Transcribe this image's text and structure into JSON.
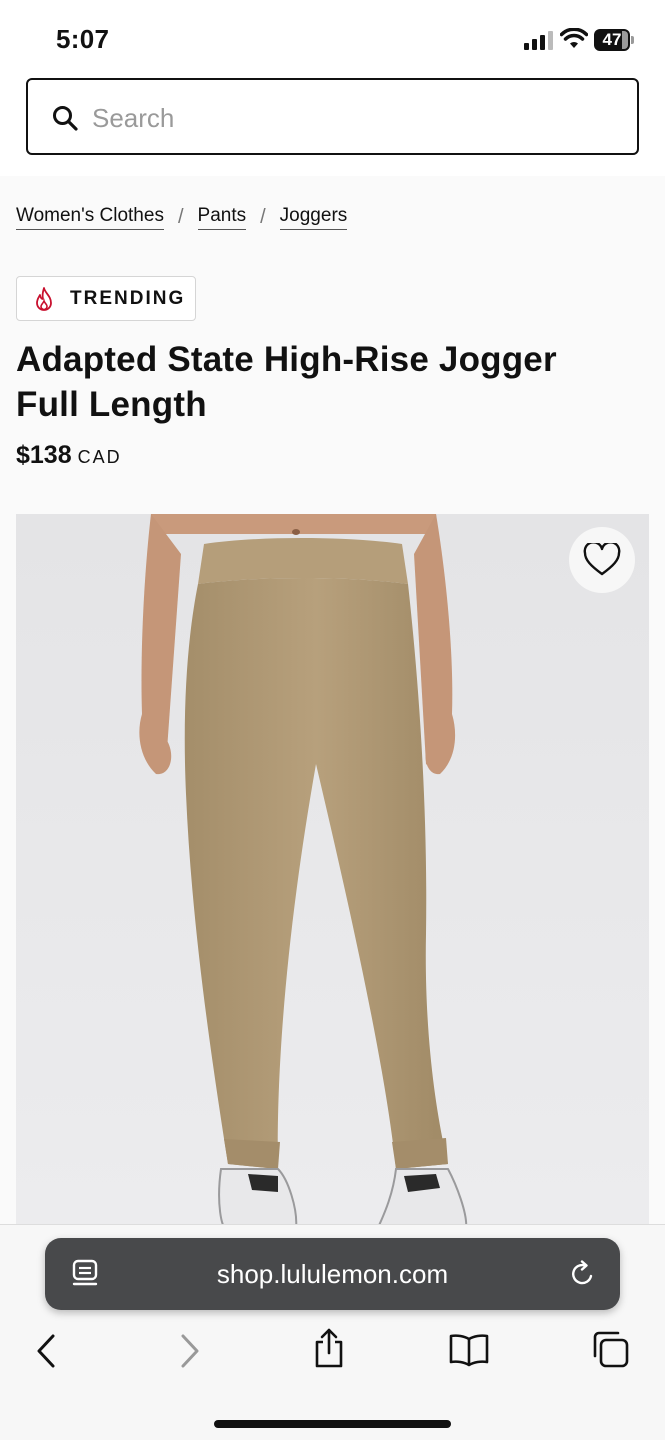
{
  "status_bar": {
    "time": "5:07",
    "battery": "47"
  },
  "search": {
    "placeholder": "Search",
    "value": ""
  },
  "breadcrumb": [
    {
      "label": "Women's Clothes"
    },
    {
      "label": "Pants"
    },
    {
      "label": "Joggers"
    }
  ],
  "breadcrumb_separator": "/",
  "badge": {
    "label": "TRENDING",
    "icon": "flame-icon",
    "icon_color": "#c8102e"
  },
  "product": {
    "title_line1": "Adapted State High-Rise Jogger",
    "title_line2": "Full Length",
    "price": "$138",
    "currency": "CAD",
    "favorite_icon": "heart-outline-icon",
    "pant_color": "#b09a76"
  },
  "browser": {
    "url": "shop.lululemon.com",
    "tab_icon": "tab-overview-icon",
    "reload_icon": "reload-icon",
    "toolbar": [
      "back-icon",
      "forward-icon",
      "share-icon",
      "bookmarks-icon",
      "tabs-icon"
    ]
  }
}
